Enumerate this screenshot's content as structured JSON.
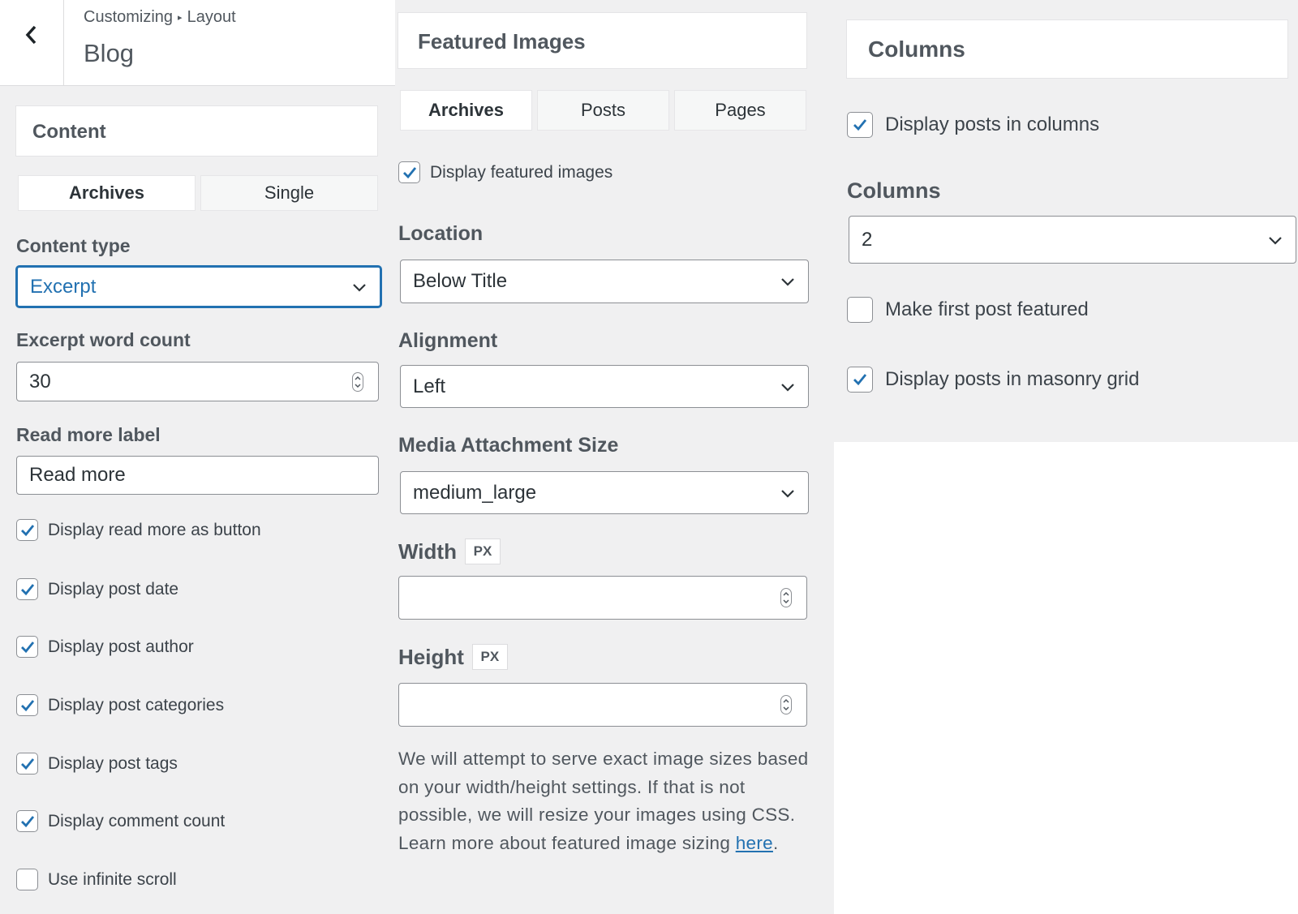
{
  "header": {
    "breadcrumb_parent": "Customizing",
    "breadcrumb_separator": "▸",
    "breadcrumb_child": "Layout",
    "title": "Blog"
  },
  "content": {
    "section_title": "Content",
    "tabs": [
      {
        "label": "Archives",
        "active": true
      },
      {
        "label": "Single",
        "active": false
      }
    ],
    "content_type_label": "Content type",
    "content_type_value": "Excerpt",
    "excerpt_count_label": "Excerpt word count",
    "excerpt_count_value": "30",
    "read_more_label": "Read more label",
    "read_more_value": "Read more",
    "checkboxes": [
      {
        "label": "Display read more as button",
        "checked": true
      },
      {
        "label": "Display post date",
        "checked": true
      },
      {
        "label": "Display post author",
        "checked": true
      },
      {
        "label": "Display post categories",
        "checked": true
      },
      {
        "label": "Display post tags",
        "checked": true
      },
      {
        "label": "Display comment count",
        "checked": true
      },
      {
        "label": "Use infinite scroll",
        "checked": false
      }
    ]
  },
  "featured": {
    "section_title": "Featured Images",
    "tabs": [
      {
        "label": "Archives",
        "active": true
      },
      {
        "label": "Posts",
        "active": false
      },
      {
        "label": "Pages",
        "active": false
      }
    ],
    "display_checkbox": {
      "label": "Display featured images",
      "checked": true
    },
    "location_label": "Location",
    "location_value": "Below Title",
    "alignment_label": "Alignment",
    "alignment_value": "Left",
    "media_size_label": "Media Attachment Size",
    "media_size_value": "medium_large",
    "width_label": "Width",
    "width_unit": "PX",
    "width_value": "",
    "height_label": "Height",
    "height_unit": "PX",
    "height_value": "",
    "description": "We will attempt to serve exact image sizes based on your width/height settings. If that is not possible, we will resize your images using CSS. Learn more about featured image sizing ",
    "description_link": "here",
    "description_end": "."
  },
  "columns": {
    "section_title": "Columns",
    "display_columns": {
      "label": "Display posts in columns",
      "checked": true
    },
    "columns_label": "Columns",
    "columns_value": "2",
    "first_featured": {
      "label": "Make first post featured",
      "checked": false
    },
    "masonry": {
      "label": "Display posts in masonry grid",
      "checked": true
    }
  },
  "colors": {
    "accent": "#2271b1",
    "panel_bg": "#f0f0f1",
    "text": "#3c434a"
  }
}
